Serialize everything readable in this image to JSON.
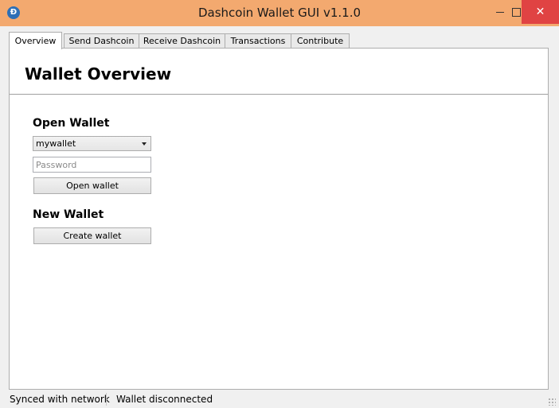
{
  "window": {
    "title": "Dashcoin Wallet GUI v1.1.0",
    "icon_letter": "Đ",
    "icon": "dashcoin-logo-icon",
    "controls": {
      "minimize": "minimize-icon",
      "maximize": "maximize-icon",
      "close": "close-icon"
    }
  },
  "tabs": [
    {
      "label": "Overview",
      "active": true
    },
    {
      "label": "Send Dashcoin",
      "active": false
    },
    {
      "label": "Receive Dashcoin",
      "active": false
    },
    {
      "label": "Transactions",
      "active": false
    },
    {
      "label": "Contribute",
      "active": false
    }
  ],
  "main": {
    "title": "Wallet Overview",
    "open_wallet": {
      "heading": "Open Wallet",
      "wallet_select_value": "mywallet",
      "password_placeholder": "Password",
      "password_value": "",
      "open_button": "Open wallet"
    },
    "new_wallet": {
      "heading": "New Wallet",
      "create_button": "Create wallet"
    }
  },
  "status": {
    "sync": "Synced with network",
    "wallet": "Wallet disconnected"
  },
  "colors": {
    "titlebar": "#f3a96f",
    "close_button": "#e04343",
    "icon_blue": "#2d6fb6"
  }
}
